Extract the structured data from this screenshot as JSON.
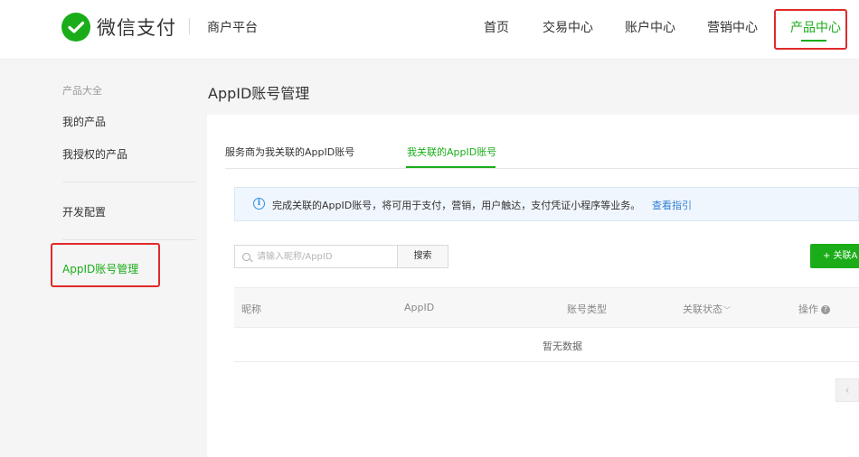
{
  "header": {
    "brand": "微信支付",
    "platform": "商户平台",
    "nav": [
      "首页",
      "交易中心",
      "账户中心",
      "营销中心",
      "产品中心"
    ],
    "active_nav": "产品中心"
  },
  "sidebar": {
    "section_title": "产品大全",
    "items": [
      "我的产品",
      "我授权的产品",
      "开发配置",
      "AppID账号管理"
    ],
    "active_item": "AppID账号管理"
  },
  "page": {
    "title": "AppID账号管理"
  },
  "tabs": [
    "服务商为我关联的AppID账号",
    "我关联的AppID账号"
  ],
  "active_tab": "我关联的AppID账号",
  "notice": {
    "icon": "info-icon",
    "text": "完成关联的AppID账号，将可用于支付，营销，用户触达，支付凭证小程序等业务。",
    "link": "查看指引"
  },
  "search": {
    "placeholder": "请输入昵称/AppID",
    "value": "",
    "button_label": "搜索"
  },
  "add_button_label": "+ 关联A",
  "table": {
    "columns": [
      "昵称",
      "AppID",
      "账号类型",
      "关联状态",
      "操作"
    ],
    "empty_text": "暂无数据"
  },
  "pager": {
    "prev_label": "‹"
  },
  "colors": {
    "brand_green": "#1aad19",
    "highlight_red": "#e02a2a",
    "link_blue": "#2f7fd6"
  }
}
